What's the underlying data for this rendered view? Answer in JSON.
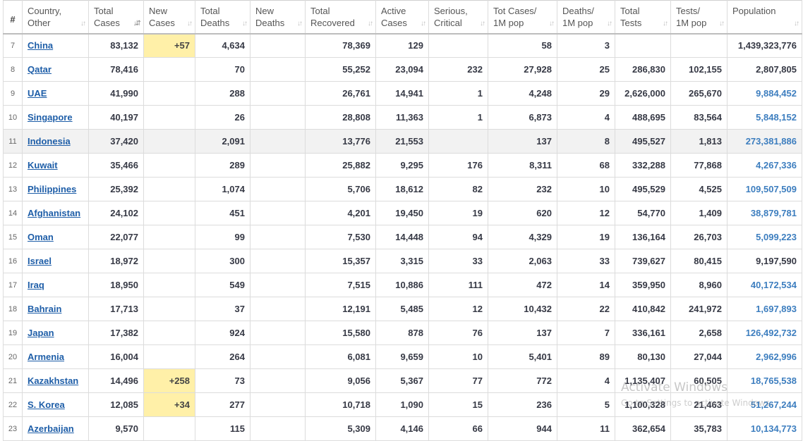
{
  "headers": [
    {
      "line1": "#",
      "line2": "",
      "sortable": false
    },
    {
      "line1": "Country,",
      "line2": "Other",
      "sortable": true,
      "active": false
    },
    {
      "line1": "Total",
      "line2": "Cases",
      "sortable": true,
      "active": true
    },
    {
      "line1": "New",
      "line2": "Cases",
      "sortable": true,
      "active": false
    },
    {
      "line1": "Total",
      "line2": "Deaths",
      "sortable": true,
      "active": false
    },
    {
      "line1": "New",
      "line2": "Deaths",
      "sortable": true,
      "active": false
    },
    {
      "line1": "Total",
      "line2": "Recovered",
      "sortable": true,
      "active": false
    },
    {
      "line1": "Active",
      "line2": "Cases",
      "sortable": true,
      "active": false
    },
    {
      "line1": "Serious,",
      "line2": "Critical",
      "sortable": true,
      "active": false
    },
    {
      "line1": "Tot Cases/",
      "line2": "1M pop",
      "sortable": true,
      "active": false
    },
    {
      "line1": "Deaths/",
      "line2": "1M pop",
      "sortable": true,
      "active": false
    },
    {
      "line1": "Total",
      "line2": "Tests",
      "sortable": true,
      "active": false
    },
    {
      "line1": "Tests/",
      "line2": "1M pop",
      "sortable": true,
      "active": false
    },
    {
      "line1": "Population",
      "line2": "",
      "sortable": true,
      "active": false
    }
  ],
  "sort_icon_glyph": "↓↑",
  "sort_icon_active_glyph": "↓⇵",
  "highlight_color": "#fff0a8",
  "link_color": "#1e5ea8",
  "rows": [
    {
      "rank": "7",
      "country": "China",
      "total_cases": "83,132",
      "new_cases": "+57",
      "total_deaths": "4,634",
      "new_deaths": "",
      "total_recovered": "78,369",
      "active_cases": "129",
      "serious": "",
      "cases_per_1m": "58",
      "deaths_per_1m": "3",
      "total_tests": "",
      "tests_per_1m": "",
      "population": "1,439,323,776",
      "pop_link": false,
      "hover": false
    },
    {
      "rank": "8",
      "country": "Qatar",
      "total_cases": "78,416",
      "new_cases": "",
      "total_deaths": "70",
      "new_deaths": "",
      "total_recovered": "55,252",
      "active_cases": "23,094",
      "serious": "232",
      "cases_per_1m": "27,928",
      "deaths_per_1m": "25",
      "total_tests": "286,830",
      "tests_per_1m": "102,155",
      "population": "2,807,805",
      "pop_link": false,
      "hover": false
    },
    {
      "rank": "9",
      "country": "UAE",
      "total_cases": "41,990",
      "new_cases": "",
      "total_deaths": "288",
      "new_deaths": "",
      "total_recovered": "26,761",
      "active_cases": "14,941",
      "serious": "1",
      "cases_per_1m": "4,248",
      "deaths_per_1m": "29",
      "total_tests": "2,626,000",
      "tests_per_1m": "265,670",
      "population": "9,884,452",
      "pop_link": true,
      "hover": false
    },
    {
      "rank": "10",
      "country": "Singapore",
      "total_cases": "40,197",
      "new_cases": "",
      "total_deaths": "26",
      "new_deaths": "",
      "total_recovered": "28,808",
      "active_cases": "11,363",
      "serious": "1",
      "cases_per_1m": "6,873",
      "deaths_per_1m": "4",
      "total_tests": "488,695",
      "tests_per_1m": "83,564",
      "population": "5,848,152",
      "pop_link": true,
      "hover": false
    },
    {
      "rank": "11",
      "country": "Indonesia",
      "total_cases": "37,420",
      "new_cases": "",
      "total_deaths": "2,091",
      "new_deaths": "",
      "total_recovered": "13,776",
      "active_cases": "21,553",
      "serious": "",
      "cases_per_1m": "137",
      "deaths_per_1m": "8",
      "total_tests": "495,527",
      "tests_per_1m": "1,813",
      "population": "273,381,886",
      "pop_link": true,
      "hover": true
    },
    {
      "rank": "12",
      "country": "Kuwait",
      "total_cases": "35,466",
      "new_cases": "",
      "total_deaths": "289",
      "new_deaths": "",
      "total_recovered": "25,882",
      "active_cases": "9,295",
      "serious": "176",
      "cases_per_1m": "8,311",
      "deaths_per_1m": "68",
      "total_tests": "332,288",
      "tests_per_1m": "77,868",
      "population": "4,267,336",
      "pop_link": true,
      "hover": false
    },
    {
      "rank": "13",
      "country": "Philippines",
      "total_cases": "25,392",
      "new_cases": "",
      "total_deaths": "1,074",
      "new_deaths": "",
      "total_recovered": "5,706",
      "active_cases": "18,612",
      "serious": "82",
      "cases_per_1m": "232",
      "deaths_per_1m": "10",
      "total_tests": "495,529",
      "tests_per_1m": "4,525",
      "population": "109,507,509",
      "pop_link": true,
      "hover": false
    },
    {
      "rank": "14",
      "country": "Afghanistan",
      "total_cases": "24,102",
      "new_cases": "",
      "total_deaths": "451",
      "new_deaths": "",
      "total_recovered": "4,201",
      "active_cases": "19,450",
      "serious": "19",
      "cases_per_1m": "620",
      "deaths_per_1m": "12",
      "total_tests": "54,770",
      "tests_per_1m": "1,409",
      "population": "38,879,781",
      "pop_link": true,
      "hover": false
    },
    {
      "rank": "15",
      "country": "Oman",
      "total_cases": "22,077",
      "new_cases": "",
      "total_deaths": "99",
      "new_deaths": "",
      "total_recovered": "7,530",
      "active_cases": "14,448",
      "serious": "94",
      "cases_per_1m": "4,329",
      "deaths_per_1m": "19",
      "total_tests": "136,164",
      "tests_per_1m": "26,703",
      "population": "5,099,223",
      "pop_link": true,
      "hover": false
    },
    {
      "rank": "16",
      "country": "Israel",
      "total_cases": "18,972",
      "new_cases": "",
      "total_deaths": "300",
      "new_deaths": "",
      "total_recovered": "15,357",
      "active_cases": "3,315",
      "serious": "33",
      "cases_per_1m": "2,063",
      "deaths_per_1m": "33",
      "total_tests": "739,627",
      "tests_per_1m": "80,415",
      "population": "9,197,590",
      "pop_link": false,
      "hover": false
    },
    {
      "rank": "17",
      "country": "Iraq",
      "total_cases": "18,950",
      "new_cases": "",
      "total_deaths": "549",
      "new_deaths": "",
      "total_recovered": "7,515",
      "active_cases": "10,886",
      "serious": "111",
      "cases_per_1m": "472",
      "deaths_per_1m": "14",
      "total_tests": "359,950",
      "tests_per_1m": "8,960",
      "population": "40,172,534",
      "pop_link": true,
      "hover": false
    },
    {
      "rank": "18",
      "country": "Bahrain",
      "total_cases": "17,713",
      "new_cases": "",
      "total_deaths": "37",
      "new_deaths": "",
      "total_recovered": "12,191",
      "active_cases": "5,485",
      "serious": "12",
      "cases_per_1m": "10,432",
      "deaths_per_1m": "22",
      "total_tests": "410,842",
      "tests_per_1m": "241,972",
      "population": "1,697,893",
      "pop_link": true,
      "hover": false
    },
    {
      "rank": "19",
      "country": "Japan",
      "total_cases": "17,382",
      "new_cases": "",
      "total_deaths": "924",
      "new_deaths": "",
      "total_recovered": "15,580",
      "active_cases": "878",
      "serious": "76",
      "cases_per_1m": "137",
      "deaths_per_1m": "7",
      "total_tests": "336,161",
      "tests_per_1m": "2,658",
      "population": "126,492,732",
      "pop_link": true,
      "hover": false
    },
    {
      "rank": "20",
      "country": "Armenia",
      "total_cases": "16,004",
      "new_cases": "",
      "total_deaths": "264",
      "new_deaths": "",
      "total_recovered": "6,081",
      "active_cases": "9,659",
      "serious": "10",
      "cases_per_1m": "5,401",
      "deaths_per_1m": "89",
      "total_tests": "80,130",
      "tests_per_1m": "27,044",
      "population": "2,962,996",
      "pop_link": true,
      "hover": false
    },
    {
      "rank": "21",
      "country": "Kazakhstan",
      "total_cases": "14,496",
      "new_cases": "+258",
      "total_deaths": "73",
      "new_deaths": "",
      "total_recovered": "9,056",
      "active_cases": "5,367",
      "serious": "77",
      "cases_per_1m": "772",
      "deaths_per_1m": "4",
      "total_tests": "1,135,407",
      "tests_per_1m": "60,505",
      "population": "18,765,538",
      "pop_link": true,
      "hover": false
    },
    {
      "rank": "22",
      "country": "S. Korea",
      "total_cases": "12,085",
      "new_cases": "+34",
      "total_deaths": "277",
      "new_deaths": "",
      "total_recovered": "10,718",
      "active_cases": "1,090",
      "serious": "15",
      "cases_per_1m": "236",
      "deaths_per_1m": "5",
      "total_tests": "1,100,328",
      "tests_per_1m": "21,463",
      "population": "51,267,244",
      "pop_link": true,
      "hover": false
    },
    {
      "rank": "23",
      "country": "Azerbaijan",
      "total_cases": "9,570",
      "new_cases": "",
      "total_deaths": "115",
      "new_deaths": "",
      "total_recovered": "5,309",
      "active_cases": "4,146",
      "serious": "66",
      "cases_per_1m": "944",
      "deaths_per_1m": "11",
      "total_tests": "362,654",
      "tests_per_1m": "35,783",
      "population": "10,134,773",
      "pop_link": true,
      "hover": false
    }
  ],
  "watermark": {
    "title": "Activate Windows",
    "subtitle": "Go to Settings to activate Windows."
  }
}
